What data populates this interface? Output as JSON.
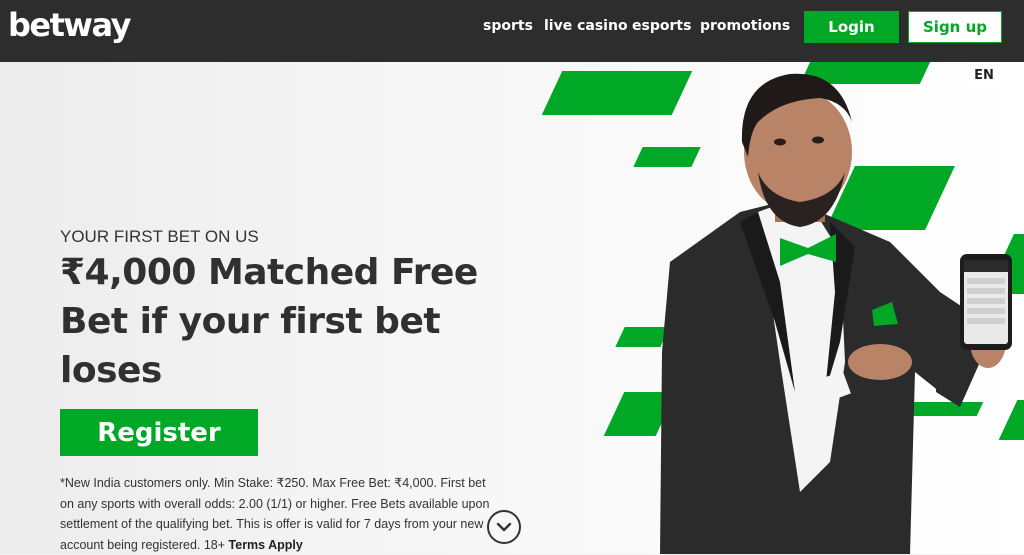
{
  "header": {
    "logo": "betway",
    "nav": [
      "sports",
      "live casino",
      "esports",
      "promotions"
    ],
    "login_label": "Login",
    "signup_label": "Sign up"
  },
  "language": "EN",
  "hero": {
    "eyebrow": "YOUR FIRST BET ON US",
    "headline": "₹4,000 Matched Free Bet if your first bet loses",
    "register_label": "Register",
    "terms_text": "*New India customers only. Min Stake: ₹250. Max Free Bet: ₹4,000. First bet on any sports with overall odds: 2.00 (1/1) or higher. Free Bets available upon settlement of the qualifying bet. This is offer is valid for 7 days from your new account being registered. 18+",
    "terms_link": "Terms Apply"
  },
  "icons": {
    "scroll": "chevron-down-icon",
    "promo_person": "presenter-with-phone-illustration"
  },
  "colors": {
    "brand_green": "#00a826",
    "header_bg": "#2d2d2d"
  }
}
